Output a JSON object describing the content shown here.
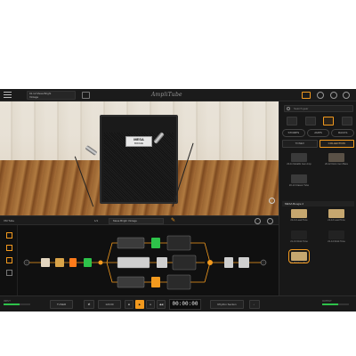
{
  "topbar": {
    "preset_line1": "01.12 Mesa Bright",
    "preset_line2": "Vintage",
    "logo": "AmpliTube"
  },
  "right_panel": {
    "search_placeholder": "Search gear",
    "filters": [
      "STOMPS",
      "AMPS",
      "RACKS"
    ],
    "tabs": [
      "TONEX",
      "COLLECTION"
    ],
    "presets_top": [
      {
        "name": "20-11 Metallic Gen Amp",
        "color": "#3a3a3a"
      },
      {
        "name": "20-12 Dorm Gen Bass",
        "color": "#5a5146"
      },
      {
        "name": "20-13 Classic Tube",
        "color": "#3a3a3a"
      }
    ],
    "section_title": "MESA Boogie 2",
    "presets_bottom": [
      {
        "name": "21-11 Lead Tone",
        "color": "#c6a76f"
      },
      {
        "name": "21-12 Lead Tone",
        "color": "#c6a76f"
      },
      {
        "name": "21-13 Rock Tone",
        "color": "#222222"
      },
      {
        "name": "21-14 Rock Tone",
        "color": "#222222"
      },
      {
        "name": "21-15 Mesa Tone",
        "color": "#c6a76f"
      }
    ]
  },
  "signal_header": {
    "left_tag": "VM Tube",
    "mid_tag": "1/1",
    "preset_name": "Mesa Bright Vintage"
  },
  "transport": {
    "input_label": "INPUT",
    "output_label": "OUTPUT",
    "bpm": "120.00",
    "counter": "00:00:00",
    "tuner_label": "TUNER",
    "record_label": "Rhythm Section"
  },
  "colors": {
    "accent": "#f39a1e",
    "meter_green": "#2ec24a",
    "background": "#141414"
  }
}
